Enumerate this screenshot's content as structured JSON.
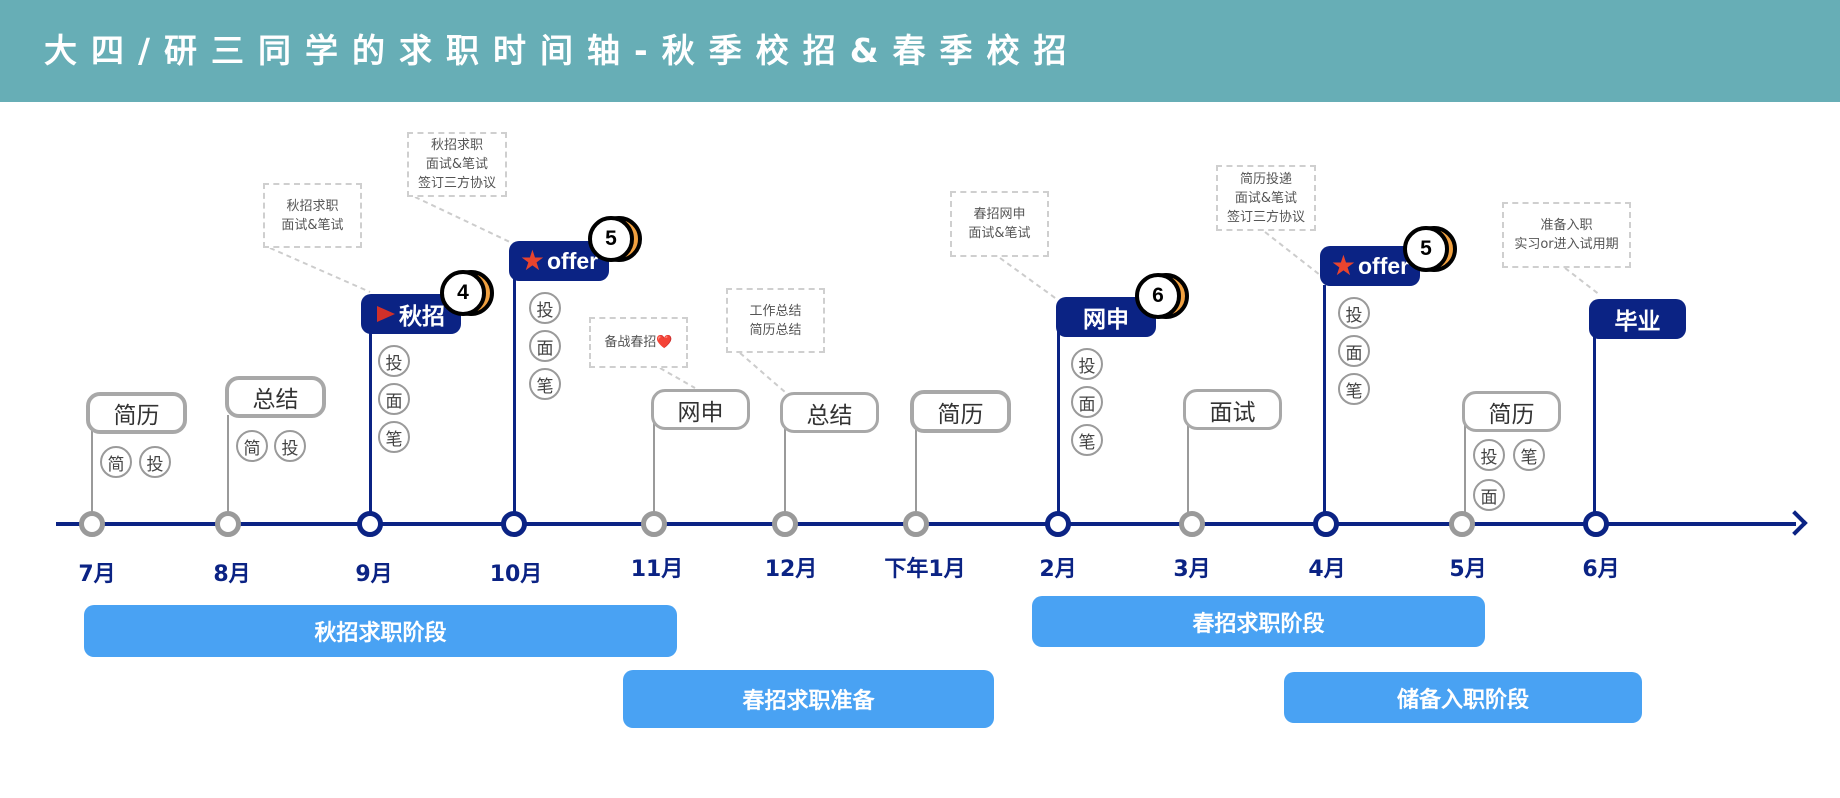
{
  "title": "大四/研三同学的求职时间轴-秋季校招&春季校招",
  "months": [
    "7月",
    "8月",
    "9月",
    "10月",
    "11月",
    "12月",
    "下年1月",
    "2月",
    "3月",
    "4月",
    "5月",
    "6月"
  ],
  "events": {
    "jul": {
      "label": "简历",
      "chips": [
        "简",
        "投"
      ]
    },
    "aug": {
      "label": "总结",
      "chips": [
        "简",
        "投"
      ]
    },
    "sep": {
      "label": "秋招",
      "badge": "4",
      "chips": [
        "投",
        "面",
        "笔"
      ],
      "note": [
        "秋招求职",
        "面试&笔试"
      ]
    },
    "oct": {
      "label": "offer",
      "badge": "5",
      "chips": [
        "投",
        "面",
        "笔"
      ],
      "note": [
        "秋招求职",
        "面试&笔试",
        "签订三方协议"
      ]
    },
    "nov": {
      "label": "网申",
      "note": [
        "备战春招❤️"
      ]
    },
    "dec": {
      "label": "总结",
      "note": [
        "工作总结",
        "简历总结"
      ]
    },
    "jan": {
      "label": "简历"
    },
    "feb": {
      "label": "网申",
      "badge": "6",
      "chips": [
        "投",
        "面",
        "笔"
      ],
      "note": [
        "春招网申",
        "面试&笔试"
      ]
    },
    "mar": {
      "label": "面试"
    },
    "apr": {
      "label": "offer",
      "badge": "5",
      "chips": [
        "投",
        "面",
        "笔"
      ],
      "note": [
        "简历投递",
        "面试&笔试",
        "签订三方协议"
      ]
    },
    "may": {
      "label": "简历",
      "chips": [
        "投",
        "笔",
        "面"
      ]
    },
    "jun": {
      "label": "毕业",
      "note": [
        "准备入职",
        "实习or进入试用期"
      ]
    }
  },
  "phases": {
    "autumn": "秋招求职阶段",
    "spring_prep": "春招求职准备",
    "spring": "春招求职阶段",
    "onboard": "储备入职阶段"
  },
  "colors": {
    "header": "#67aeb6",
    "navy": "#0b2384",
    "phase": "#49a2f3",
    "gray": "#9a9a9a",
    "badge_orange": "#f0a040"
  }
}
